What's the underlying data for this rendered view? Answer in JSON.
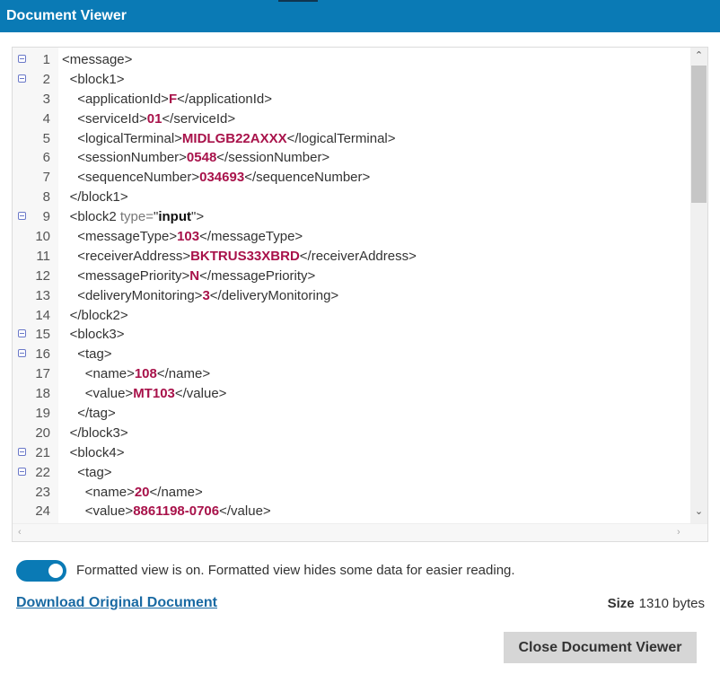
{
  "window": {
    "title": "Document Viewer"
  },
  "code_lines": [
    {
      "num": "1",
      "fold": true,
      "indent": 0,
      "parts": [
        {
          "t": "<message>",
          "c": "tag"
        }
      ]
    },
    {
      "num": "2",
      "fold": true,
      "indent": 1,
      "parts": [
        {
          "t": "<block1>",
          "c": "tag"
        }
      ]
    },
    {
      "num": "3",
      "fold": false,
      "indent": 2,
      "parts": [
        {
          "t": "<applicationId>",
          "c": "tag"
        },
        {
          "t": "F",
          "c": "val"
        },
        {
          "t": "</applicationId>",
          "c": "tag"
        }
      ]
    },
    {
      "num": "4",
      "fold": false,
      "indent": 2,
      "parts": [
        {
          "t": "<serviceId>",
          "c": "tag"
        },
        {
          "t": "01",
          "c": "val"
        },
        {
          "t": "</serviceId>",
          "c": "tag"
        }
      ]
    },
    {
      "num": "5",
      "fold": false,
      "indent": 2,
      "parts": [
        {
          "t": "<logicalTerminal>",
          "c": "tag"
        },
        {
          "t": "MIDLGB22AXXX",
          "c": "val"
        },
        {
          "t": "</logicalTerminal>",
          "c": "tag"
        }
      ]
    },
    {
      "num": "6",
      "fold": false,
      "indent": 2,
      "parts": [
        {
          "t": "<sessionNumber>",
          "c": "tag"
        },
        {
          "t": "0548",
          "c": "val"
        },
        {
          "t": "</sessionNumber>",
          "c": "tag"
        }
      ]
    },
    {
      "num": "7",
      "fold": false,
      "indent": 2,
      "parts": [
        {
          "t": "<sequenceNumber>",
          "c": "tag"
        },
        {
          "t": "034693",
          "c": "val"
        },
        {
          "t": "</sequenceNumber>",
          "c": "tag"
        }
      ]
    },
    {
      "num": "8",
      "fold": false,
      "indent": 1,
      "parts": [
        {
          "t": "</block1>",
          "c": "tag"
        }
      ]
    },
    {
      "num": "9",
      "fold": true,
      "indent": 1,
      "parts": [
        {
          "t": "<block2 ",
          "c": "tag"
        },
        {
          "t": "type=",
          "c": "attr"
        },
        {
          "t": "\"",
          "c": "strq"
        },
        {
          "t": "input",
          "c": "strv"
        },
        {
          "t": "\"",
          "c": "strq"
        },
        {
          "t": ">",
          "c": "tag"
        }
      ]
    },
    {
      "num": "10",
      "fold": false,
      "indent": 2,
      "parts": [
        {
          "t": "<messageType>",
          "c": "tag"
        },
        {
          "t": "103",
          "c": "val"
        },
        {
          "t": "</messageType>",
          "c": "tag"
        }
      ]
    },
    {
      "num": "11",
      "fold": false,
      "indent": 2,
      "parts": [
        {
          "t": "<receiverAddress>",
          "c": "tag"
        },
        {
          "t": "BKTRUS33XBRD",
          "c": "val"
        },
        {
          "t": "</receiverAddress>",
          "c": "tag"
        }
      ]
    },
    {
      "num": "12",
      "fold": false,
      "indent": 2,
      "parts": [
        {
          "t": "<messagePriority>",
          "c": "tag"
        },
        {
          "t": "N",
          "c": "val"
        },
        {
          "t": "</messagePriority>",
          "c": "tag"
        }
      ]
    },
    {
      "num": "13",
      "fold": false,
      "indent": 2,
      "parts": [
        {
          "t": "<deliveryMonitoring>",
          "c": "tag"
        },
        {
          "t": "3",
          "c": "val"
        },
        {
          "t": "</deliveryMonitoring>",
          "c": "tag"
        }
      ]
    },
    {
      "num": "14",
      "fold": false,
      "indent": 1,
      "parts": [
        {
          "t": "</block2>",
          "c": "tag"
        }
      ]
    },
    {
      "num": "15",
      "fold": true,
      "indent": 1,
      "parts": [
        {
          "t": "<block3>",
          "c": "tag"
        }
      ]
    },
    {
      "num": "16",
      "fold": true,
      "indent": 2,
      "parts": [
        {
          "t": "<tag>",
          "c": "tag"
        }
      ]
    },
    {
      "num": "17",
      "fold": false,
      "indent": 3,
      "parts": [
        {
          "t": "<name>",
          "c": "tag"
        },
        {
          "t": "108",
          "c": "val"
        },
        {
          "t": "</name>",
          "c": "tag"
        }
      ]
    },
    {
      "num": "18",
      "fold": false,
      "indent": 3,
      "parts": [
        {
          "t": "<value>",
          "c": "tag"
        },
        {
          "t": "MT103",
          "c": "val"
        },
        {
          "t": "</value>",
          "c": "tag"
        }
      ]
    },
    {
      "num": "19",
      "fold": false,
      "indent": 2,
      "parts": [
        {
          "t": "</tag>",
          "c": "tag"
        }
      ]
    },
    {
      "num": "20",
      "fold": false,
      "indent": 1,
      "parts": [
        {
          "t": "</block3>",
          "c": "tag"
        }
      ]
    },
    {
      "num": "21",
      "fold": true,
      "indent": 1,
      "parts": [
        {
          "t": "<block4>",
          "c": "tag"
        }
      ]
    },
    {
      "num": "22",
      "fold": true,
      "indent": 2,
      "parts": [
        {
          "t": "<tag>",
          "c": "tag"
        }
      ]
    },
    {
      "num": "23",
      "fold": false,
      "indent": 3,
      "parts": [
        {
          "t": "<name>",
          "c": "tag"
        },
        {
          "t": "20",
          "c": "val"
        },
        {
          "t": "</name>",
          "c": "tag"
        }
      ]
    },
    {
      "num": "24",
      "fold": false,
      "indent": 3,
      "parts": [
        {
          "t": "<value>",
          "c": "tag"
        },
        {
          "t": "8861198-0706",
          "c": "val"
        },
        {
          "t": "</value>",
          "c": "tag"
        }
      ]
    }
  ],
  "scrollbar": {
    "up_arrow": "⌃",
    "down_arrow": "⌄",
    "left_arrow": "‹",
    "right_arrow": "›"
  },
  "toggle": {
    "on": true,
    "label": "Formatted view is on. Formatted view hides some data for easier reading."
  },
  "download": {
    "label": "Download Original Document"
  },
  "size": {
    "label": "Size",
    "value": "1310 bytes"
  },
  "close_button": {
    "label": "Close Document Viewer"
  },
  "colors": {
    "header": "#0a7ab5",
    "value": "#a8124a",
    "link": "#1a6aa3",
    "button": "#d6d6d6"
  }
}
